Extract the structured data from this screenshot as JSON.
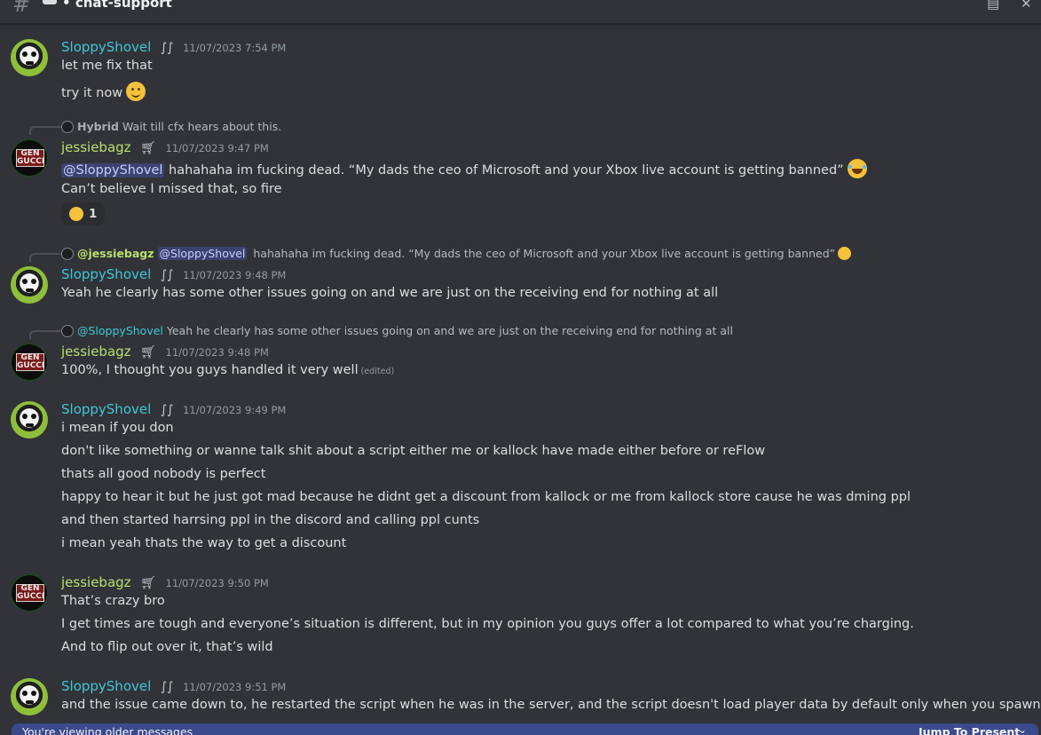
{
  "channel": {
    "name": "chat-support"
  },
  "messages": [
    {
      "author": "SloppyShovel",
      "timestamp": "11/07/2023 7:54 PM",
      "lines": [
        "let me fix that",
        "try it now"
      ]
    },
    {
      "reply": {
        "author": "Hybrid",
        "text": "Wait till cfx hears about this."
      },
      "author": "jessiebagz",
      "timestamp": "11/07/2023 9:47 PM",
      "mention": "@SloppyShovel",
      "lines": [
        " hahahaha im fucking dead. “My dads the ceo of Microsoft and your Xbox live account is getting banned”",
        "Can’t believe I missed that, so fire"
      ],
      "reaction": {
        "emoji": "rofl",
        "count": "1"
      }
    },
    {
      "reply": {
        "author": "@jessiebagz",
        "mention": "@SloppyShovel",
        "text": " hahahaha im fucking dead. “My dads the ceo of Microsoft and your Xbox live account is getting banned”"
      },
      "author": "SloppyShovel",
      "timestamp": "11/07/2023 9:48 PM",
      "lines": [
        "Yeah he clearly has some other issues going on and we are just on the receiving end for nothing at all"
      ]
    },
    {
      "reply": {
        "author": "@SloppyShovel",
        "text": "Yeah he clearly has some other issues going on and we are just on the receiving end for nothing at all"
      },
      "author": "jessiebagz",
      "timestamp": "11/07/2023 9:48 PM",
      "lines": [
        "100%, I thought you guys handled it very well"
      ],
      "edited": "(edited)"
    },
    {
      "author": "SloppyShovel",
      "timestamp": "11/07/2023 9:49 PM",
      "lines": [
        "i mean if you don",
        "don't like something or wanne talk shit about a script either me or kallock have made either before or reFlow",
        "thats all good nobody is perfect",
        "happy to hear it but he just got mad because he didnt get a discount from kallock or me from kallock store cause he was  dming ppl",
        "and then started harrsing ppl in the discord and calling ppl cunts",
        "i mean yeah thats the way to get a discount"
      ]
    },
    {
      "author": "jessiebagz",
      "timestamp": "11/07/2023 9:50 PM",
      "lines": [
        "That’s crazy bro",
        "I get times are tough and everyone’s situation is different, but in my opinion you guys offer a lot compared to what you’re charging.",
        "And to flip out over it, that’s wild"
      ]
    },
    {
      "author": "SloppyShovel",
      "timestamp": "11/07/2023 9:51 PM",
      "lines": [
        "and the issue came down to, he restarted the script when he was in the server, and the script doesn't load player data by default only when you spawn"
      ]
    }
  ],
  "bottom_bar": {
    "notice": "You're viewing older messages",
    "jump_label": "Jump To Present"
  },
  "avatars": {
    "gen_text": "GEN GUCCI"
  },
  "colors": {
    "sloppy": "#3fc7d6",
    "jessie": "#b8e06d",
    "background": "#313338"
  },
  "icons": {
    "channel": "hash-icon",
    "sloppy_badge": "wave-badge-icon",
    "jessie_badge": "cart-badge-icon"
  }
}
